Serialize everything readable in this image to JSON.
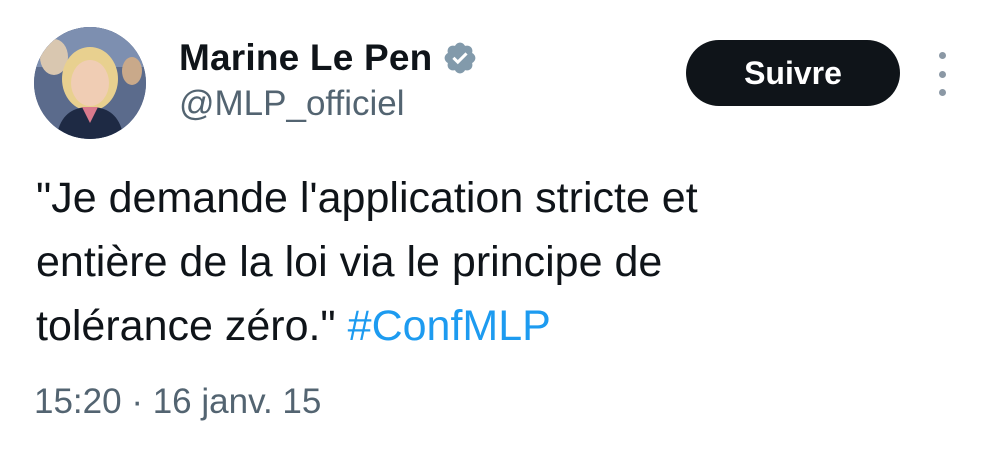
{
  "user": {
    "display_name": "Marine Le Pen",
    "handle": "@MLP_officiel",
    "verified": true,
    "verified_color": "#829aab"
  },
  "follow_button": {
    "label": "Suivre"
  },
  "tweet": {
    "text_lines": [
      "\"Je demande l'application stricte et",
      "entière de la loi via le principe de",
      "tolérance zéro.\""
    ],
    "hashtag": "#ConfMLP",
    "time": "15:20",
    "separator": "·",
    "date": "16 janv. 15"
  },
  "colors": {
    "text": "#0f1419",
    "secondary_text": "#536471",
    "link": "#1d9bf0",
    "button_bg": "#0f1419",
    "button_text": "#ffffff"
  },
  "icons": {
    "verified": "verified-badge-icon",
    "more": "more-vertical-icon"
  }
}
